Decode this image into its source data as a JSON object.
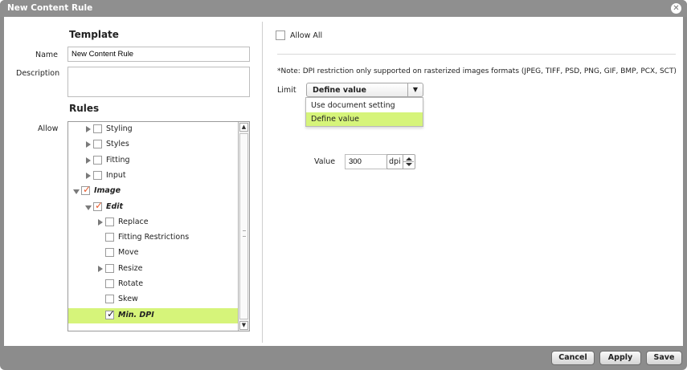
{
  "window": {
    "title": "New Content Rule"
  },
  "left": {
    "template_heading": "Template",
    "name_label": "Name",
    "name_value": "New Content Rule",
    "description_label": "Description",
    "description_value": "",
    "rules_heading": "Rules",
    "allow_label": "Allow",
    "tree": [
      {
        "label": "Styling",
        "checked": false,
        "expander": "collapsed",
        "style": "normal",
        "selected": false
      },
      {
        "label": "Styles",
        "checked": false,
        "expander": "collapsed",
        "style": "normal",
        "selected": false
      },
      {
        "label": "Fitting",
        "checked": false,
        "expander": "collapsed",
        "style": "normal",
        "selected": false
      },
      {
        "label": "Input",
        "checked": false,
        "expander": "collapsed",
        "style": "normal",
        "selected": false
      },
      {
        "label": "Image",
        "checked": true,
        "expander": "expanded",
        "style": "bold-italic",
        "selected": false
      },
      {
        "label": "Edit",
        "checked": true,
        "expander": "expanded",
        "style": "bold-italic",
        "selected": false
      },
      {
        "label": "Replace",
        "checked": false,
        "expander": "collapsed",
        "style": "normal",
        "selected": false
      },
      {
        "label": "Fitting Restrictions",
        "checked": false,
        "expander": "none",
        "style": "normal",
        "selected": false
      },
      {
        "label": "Move",
        "checked": false,
        "expander": "none",
        "style": "normal",
        "selected": false
      },
      {
        "label": "Resize",
        "checked": false,
        "expander": "collapsed",
        "style": "normal",
        "selected": false
      },
      {
        "label": "Rotate",
        "checked": false,
        "expander": "none",
        "style": "normal",
        "selected": false
      },
      {
        "label": "Skew",
        "checked": false,
        "expander": "none",
        "style": "normal",
        "selected": false
      },
      {
        "label": "Min. DPI",
        "checked": true,
        "expander": "none",
        "style": "bold-italic",
        "selected": true
      }
    ]
  },
  "right": {
    "allow_all_label": "Allow All",
    "note": "*Note: DPI restriction only supported on rasterized images formats (JPEG, TIFF, PSD, PNG, GIF, BMP, PCX, SCT)",
    "limit_label": "Limit",
    "limit_selected": "Define value",
    "limit_options": [
      "Use document setting",
      "Define value"
    ],
    "value_label": "Value",
    "value": "300",
    "unit": "dpi"
  },
  "footer": {
    "cancel": "Cancel",
    "apply": "Apply",
    "save": "Save"
  },
  "colors": {
    "selection": "#d6f47a",
    "check_red": "#e85a2c",
    "chrome": "#8c8c8c"
  }
}
